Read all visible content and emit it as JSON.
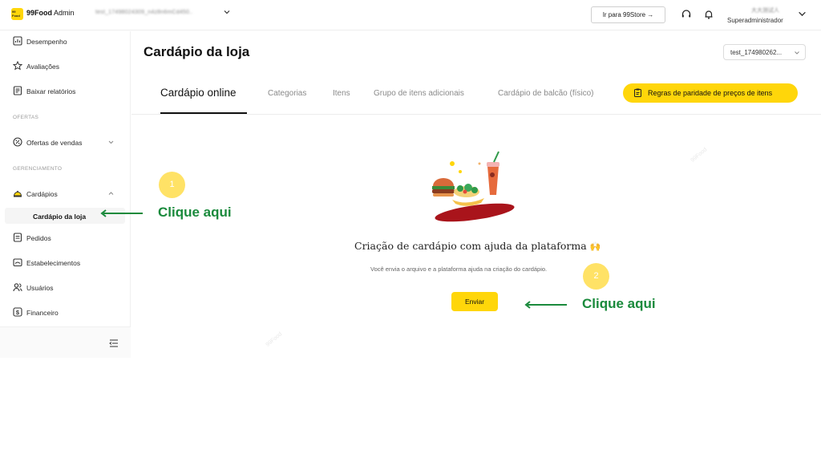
{
  "topbar": {
    "logo_text": "99 Food",
    "app_name_bold": "99Food",
    "app_name_light": " Admin",
    "store_selector_value": "test_17498024309_n4z8n6mCd450..",
    "goto_store_label": "Ir para 99Store",
    "goto_store_arrow": "→",
    "user_name": "大大测试人",
    "user_role": "Superadministrador"
  },
  "sidebar": {
    "items": [
      {
        "label": "Desempenho",
        "icon": "chart-icon"
      },
      {
        "label": "Avaliações",
        "icon": "star-icon"
      },
      {
        "label": "Baixar relatórios",
        "icon": "report-icon"
      }
    ],
    "section_offers": "OFERTAS",
    "offers_item": {
      "label": "Ofertas de vendas",
      "icon": "discount-icon"
    },
    "section_management": "GERENCIAMENTO",
    "menus_item": {
      "label": "Cardápios",
      "icon": "cloche-icon"
    },
    "menus_subitem": "Cardápio da loja",
    "more_items": [
      {
        "label": "Pedidos",
        "icon": "orders-icon"
      },
      {
        "label": "Estabelecimentos",
        "icon": "store-icon"
      },
      {
        "label": "Usuários",
        "icon": "users-icon"
      },
      {
        "label": "Financeiro",
        "icon": "dollar-icon"
      }
    ]
  },
  "main": {
    "page_title": "Cardápio da loja",
    "store_id_select": "test_174980262...",
    "tabs": [
      {
        "label": "Cardápio online",
        "active": true
      },
      {
        "label": "Categorias",
        "active": false
      },
      {
        "label": "Itens",
        "active": false
      },
      {
        "label": "Grupo de itens adicionais",
        "active": false
      },
      {
        "label": "Cardápio de balcão (físico)",
        "active": false
      }
    ],
    "parity_button_label": "Regras de paridade de preços de itens",
    "empty_state": {
      "title": "Criação de cardápio com ajuda da plataforma",
      "title_emoji": "🙌",
      "description": "Você envia o arquivo e a plataforma ajuda na criação do cardápio.",
      "send_button_label": "Enviar"
    }
  },
  "annotations": {
    "step1_number": "1",
    "step1_hint": "Clique aqui",
    "step2_number": "2",
    "step2_hint": "Clique aqui"
  },
  "colors": {
    "accent_yellow": "#ffd60a",
    "hint_green": "#1a8a3c",
    "step_circle": "#ffe266"
  }
}
